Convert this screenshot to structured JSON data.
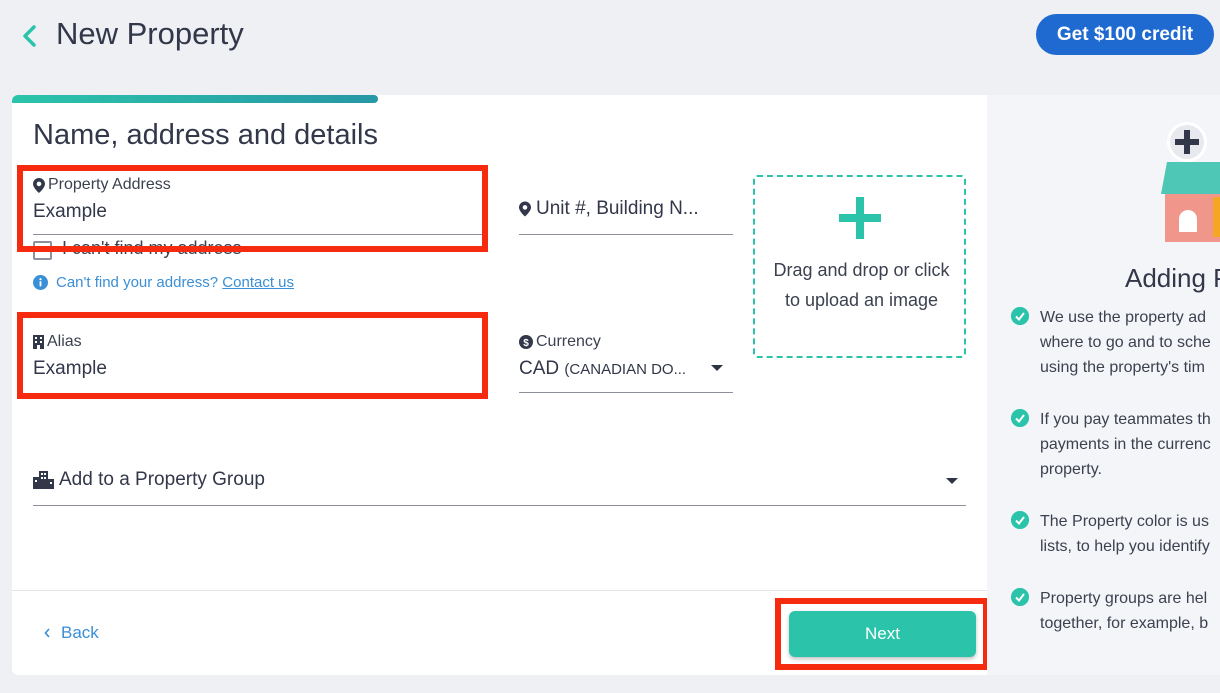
{
  "header": {
    "title": "New Property",
    "credit_button": "Get $100 credit"
  },
  "form": {
    "section_title": "Name, address and details",
    "property_address": {
      "label": "Property Address",
      "value": "Example"
    },
    "unit": {
      "placeholder": "Unit #, Building N..."
    },
    "cant_find_checkbox": "I can't find my address",
    "help_text": "Can't find your address?",
    "help_link": "Contact us",
    "alias": {
      "label": "Alias",
      "value": "Example"
    },
    "currency": {
      "label": "Currency",
      "code": "CAD",
      "name": "(CANADIAN DO..."
    },
    "property_group": {
      "placeholder": "Add to a Property Group"
    },
    "upload": {
      "text": "Drag and drop or click to upload an image"
    },
    "back_label": "Back",
    "next_label": "Next"
  },
  "side_panel": {
    "title": "Adding P",
    "tips": [
      "We use the property ad\nwhere to go and to sche\nusing the property's tim",
      "If you pay teammates th\npayments in the currenc\nproperty.",
      "The Property color is us\nlists, to help you identify",
      "Property groups are hel\ntogether, for example, b"
    ]
  },
  "colors": {
    "accent": "#2bc4aa",
    "primary_blue": "#1f6ad1",
    "highlight": "#f52a0f",
    "link": "#3a8fd6"
  }
}
